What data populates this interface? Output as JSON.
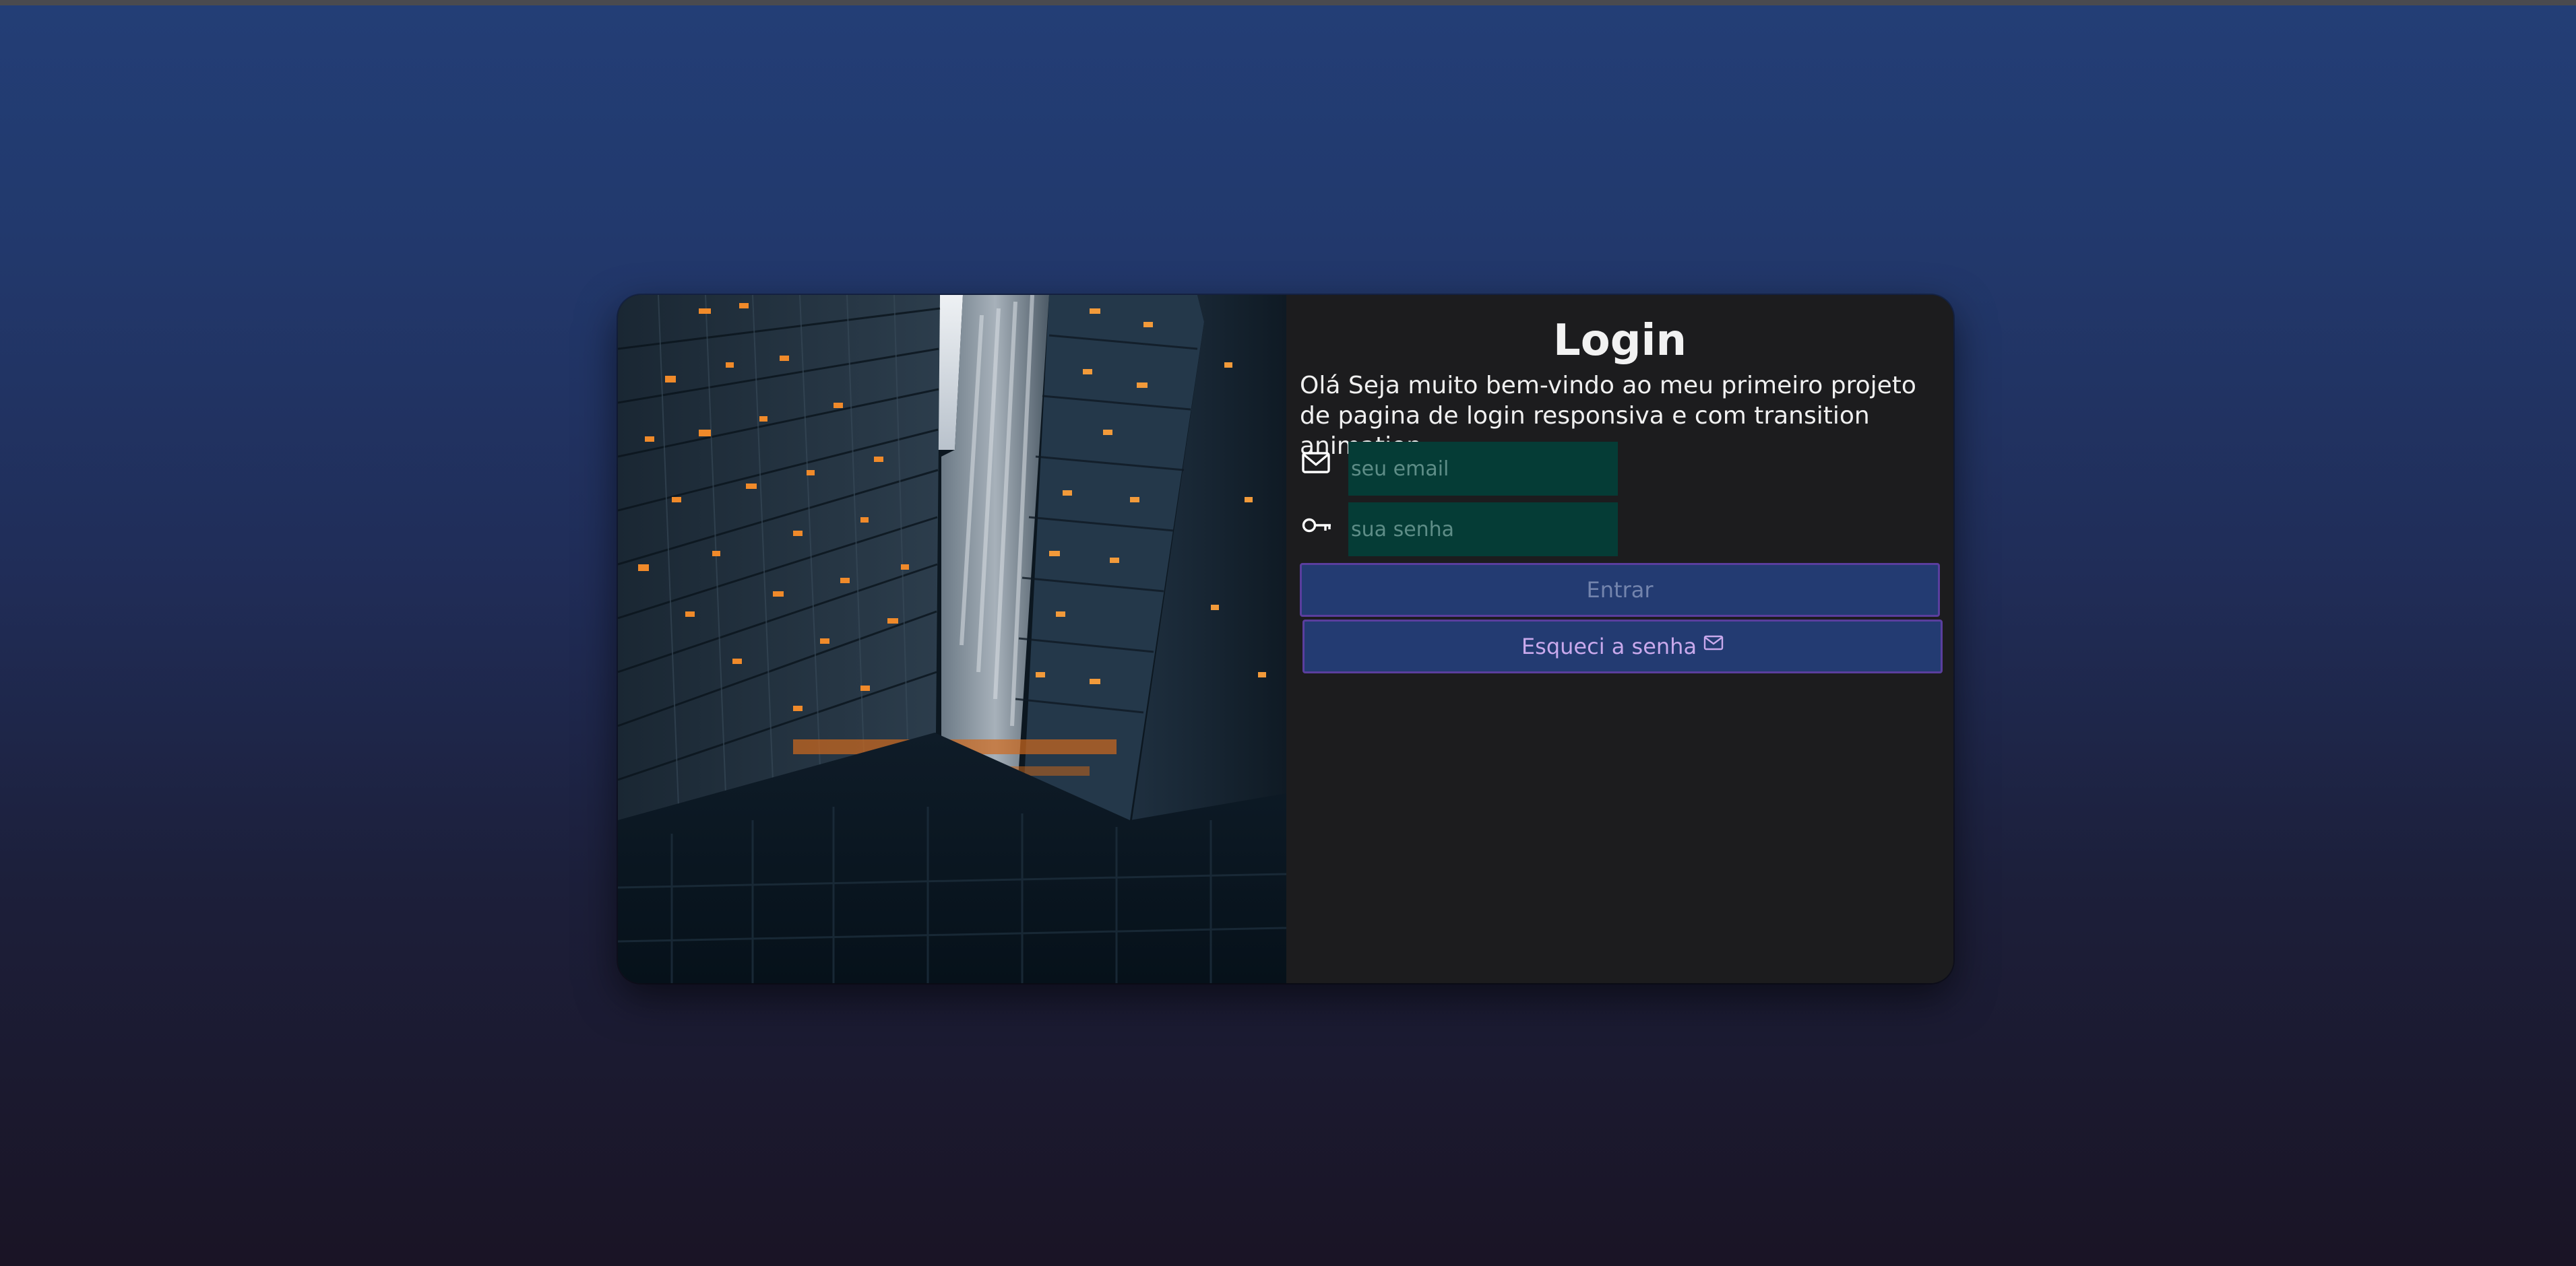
{
  "login": {
    "title": "Login",
    "intro": "Olá Seja muito bem-vindo ao meu primeiro projeto de pagina de login responsiva e com transition animation.",
    "email": {
      "value": "",
      "placeholder": "seu email",
      "icon": "envelope-icon"
    },
    "password": {
      "value": "",
      "placeholder": "sua senha",
      "icon": "key-icon"
    },
    "submit_label": "Entrar",
    "forgot_label": "Esqueci a senha",
    "forgot_icon": "envelope-icon"
  },
  "colors": {
    "background_top": "#233e76",
    "background_bottom": "#1a1425",
    "panel": "#1c1c1e",
    "input_bg": "#053c36",
    "button_bg": "#233b72",
    "button_border": "#5a3e9e",
    "forgot_text": "#c9a9ec"
  }
}
